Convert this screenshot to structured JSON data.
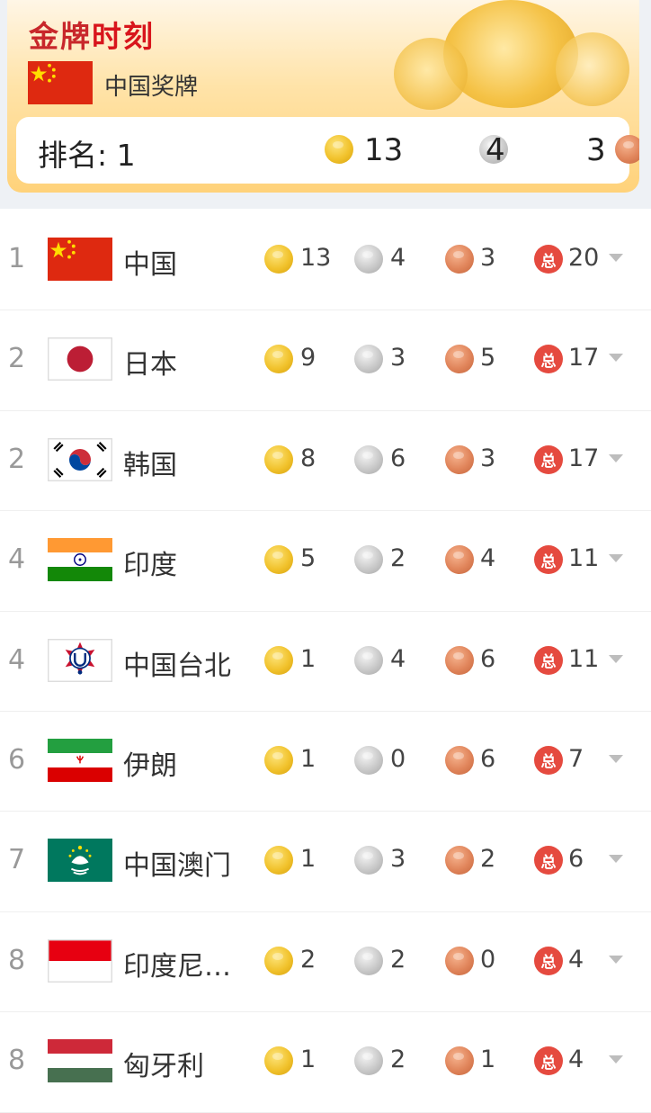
{
  "header": {
    "title_part1": "金牌",
    "title_part2": "时刻",
    "subtitle": "中国奖牌",
    "rank_label": "排名:",
    "rank": "1",
    "gold": "13",
    "silver": "4",
    "bronze": "3"
  },
  "total_icon_label": "总",
  "colors": {
    "gold": "#f1c22c",
    "silver": "#c9c9c9",
    "bronze": "#e0845a",
    "total_badge": "#e54a3f",
    "title_red": "#d8151c"
  },
  "rows": [
    {
      "rank": "1",
      "country": "中国",
      "flag": "china-flag",
      "gold": "13",
      "silver": "4",
      "bronze": "3",
      "total": "20"
    },
    {
      "rank": "2",
      "country": "日本",
      "flag": "japan-flag",
      "gold": "9",
      "silver": "3",
      "bronze": "5",
      "total": "17"
    },
    {
      "rank": "2",
      "country": "韩国",
      "flag": "korea-flag",
      "gold": "8",
      "silver": "6",
      "bronze": "3",
      "total": "17"
    },
    {
      "rank": "4",
      "country": "印度",
      "flag": "india-flag",
      "gold": "5",
      "silver": "2",
      "bronze": "4",
      "total": "11"
    },
    {
      "rank": "4",
      "country": "中国台北",
      "flag": "chinese-taipei-flag",
      "gold": "1",
      "silver": "4",
      "bronze": "6",
      "total": "11"
    },
    {
      "rank": "6",
      "country": "伊朗",
      "flag": "iran-flag",
      "gold": "1",
      "silver": "0",
      "bronze": "6",
      "total": "7"
    },
    {
      "rank": "7",
      "country": "中国澳门",
      "flag": "macau-flag",
      "gold": "1",
      "silver": "3",
      "bronze": "2",
      "total": "6"
    },
    {
      "rank": "8",
      "country": "印度尼…",
      "flag": "indonesia-flag",
      "gold": "2",
      "silver": "2",
      "bronze": "0",
      "total": "4"
    },
    {
      "rank": "8",
      "country": "匈牙利",
      "flag": "hungary-flag",
      "gold": "1",
      "silver": "2",
      "bronze": "1",
      "total": "4"
    }
  ]
}
